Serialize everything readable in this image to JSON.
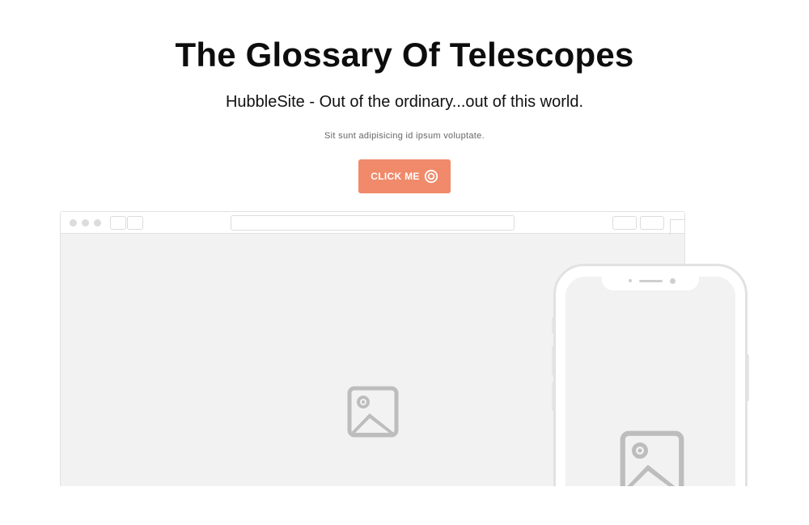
{
  "hero": {
    "title": "The Glossary Of Telescopes",
    "subtitle": "HubbleSite - Out of the ordinary...out of this world.",
    "caption": "Sit sunt adipisicing id ipsum voluptate."
  },
  "cta": {
    "label": "CLICK ME",
    "icon": "target-icon",
    "color": "#f08a6a"
  },
  "browser_mockup": {
    "placeholder_icon": "image-placeholder-icon",
    "frame_color": "#e2e2e2",
    "viewport_color": "#f2f2f2"
  },
  "phone_mockup": {
    "placeholder_icon": "image-placeholder-icon",
    "frame_color": "#e2e2e2",
    "screen_color": "#f2f2f2"
  },
  "colors": {
    "placeholder_icon": "#bdbdbd",
    "text": "#111111",
    "muted_text": "#666666"
  }
}
